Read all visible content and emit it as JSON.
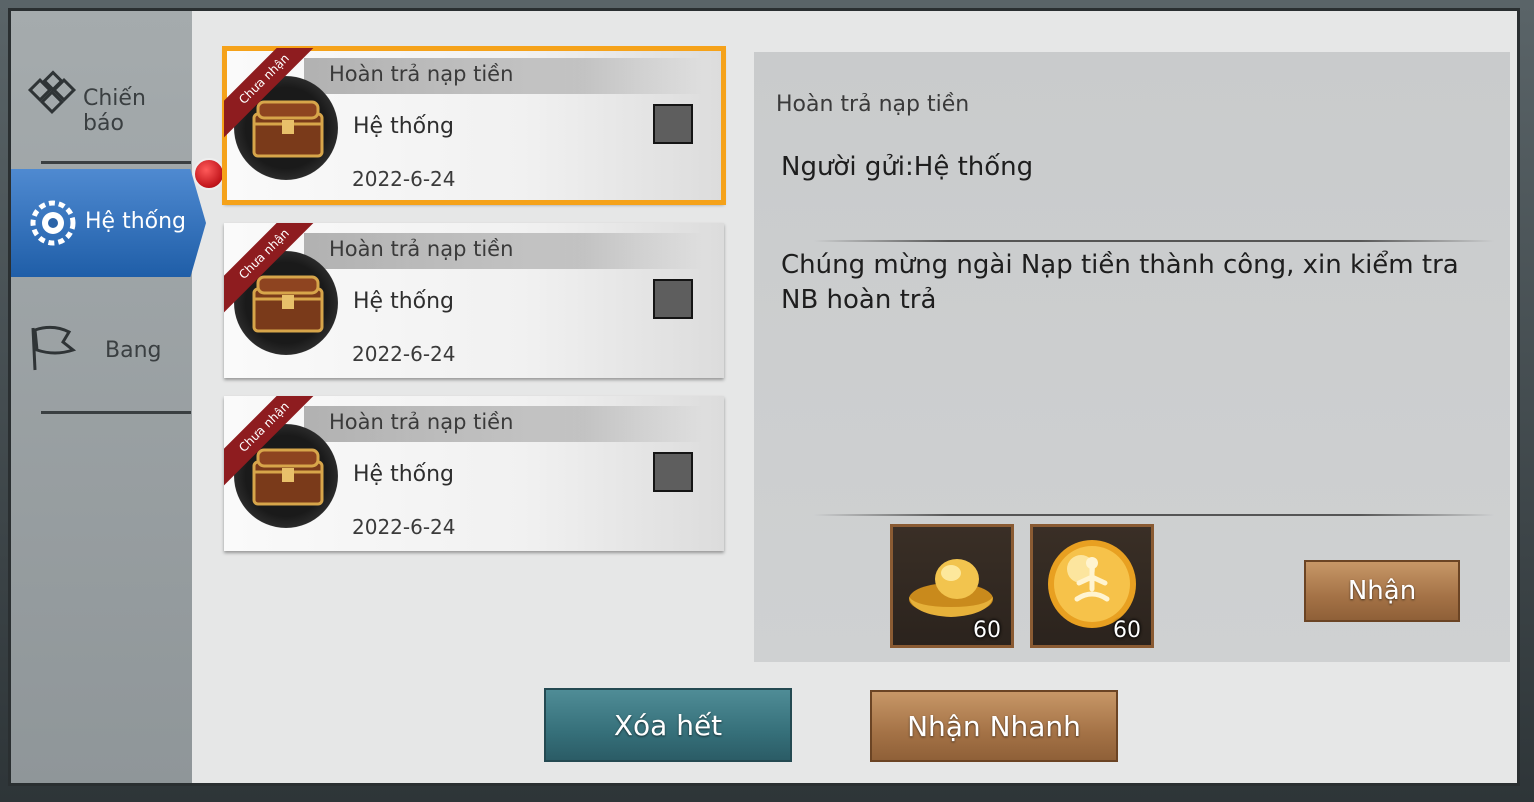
{
  "sidebar": {
    "tabs": [
      {
        "label": "Chiến báo",
        "icon": "battle-report-icon",
        "active": false
      },
      {
        "label": "Hệ thống",
        "icon": "system-gear-icon",
        "active": true
      },
      {
        "label": "Bang",
        "icon": "guild-banner-icon",
        "active": false
      }
    ]
  },
  "mails": [
    {
      "title": "Hoàn trả nạp tiền",
      "sender": "Hệ thống",
      "date": "2022-6-24",
      "ribbon": "Chưa nhận",
      "selected": true
    },
    {
      "title": "Hoàn trả nạp tiền",
      "sender": "Hệ thống",
      "date": "2022-6-24",
      "ribbon": "Chưa nhận",
      "selected": false
    },
    {
      "title": "Hoàn trả nạp tiền",
      "sender": "Hệ thống",
      "date": "2022-6-24",
      "ribbon": "Chưa nhận",
      "selected": false
    }
  ],
  "detail": {
    "title": "Hoàn trả nạp tiền",
    "sender_line": "Người gửi:Hệ thống",
    "body": "Chúng mừng ngài Nạp tiền thành công, xin kiểm tra NB hoàn trả",
    "rewards": [
      {
        "icon": "gold-ingot-icon",
        "qty": "60"
      },
      {
        "icon": "meditation-orb-icon",
        "qty": "60"
      }
    ],
    "claim_label": "Nhận"
  },
  "footer": {
    "delete_all_label": "Xóa hết",
    "quick_claim_label": "Nhận Nhanh"
  },
  "colors": {
    "selected_outline": "#f5a21a",
    "active_tab": "#2f6fb8",
    "ribbon": "#8e1c1f"
  }
}
